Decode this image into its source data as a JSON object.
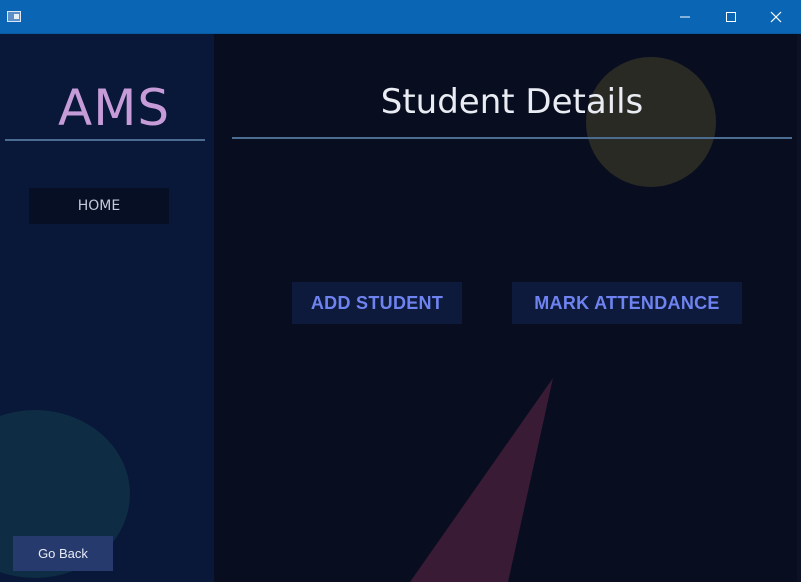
{
  "titlebar": {
    "icons": {
      "app": "window-app-icon",
      "minimize": "minimize-icon",
      "maximize": "maximize-icon",
      "close": "close-icon"
    }
  },
  "sidebar": {
    "logo": "AMS",
    "home_label": "HOME",
    "go_back_label": "Go Back"
  },
  "main": {
    "title": "Student Details",
    "add_student_label": "ADD STUDENT",
    "mark_attendance_label": "MARK ATTENDANCE"
  },
  "colors": {
    "titlebar": "#0a66b4",
    "sidebar": "#091738",
    "main": "#080e20",
    "logo": "#c59bd8",
    "accent_button_text": "#6f83f0",
    "go_back_button": "#273a6e"
  }
}
